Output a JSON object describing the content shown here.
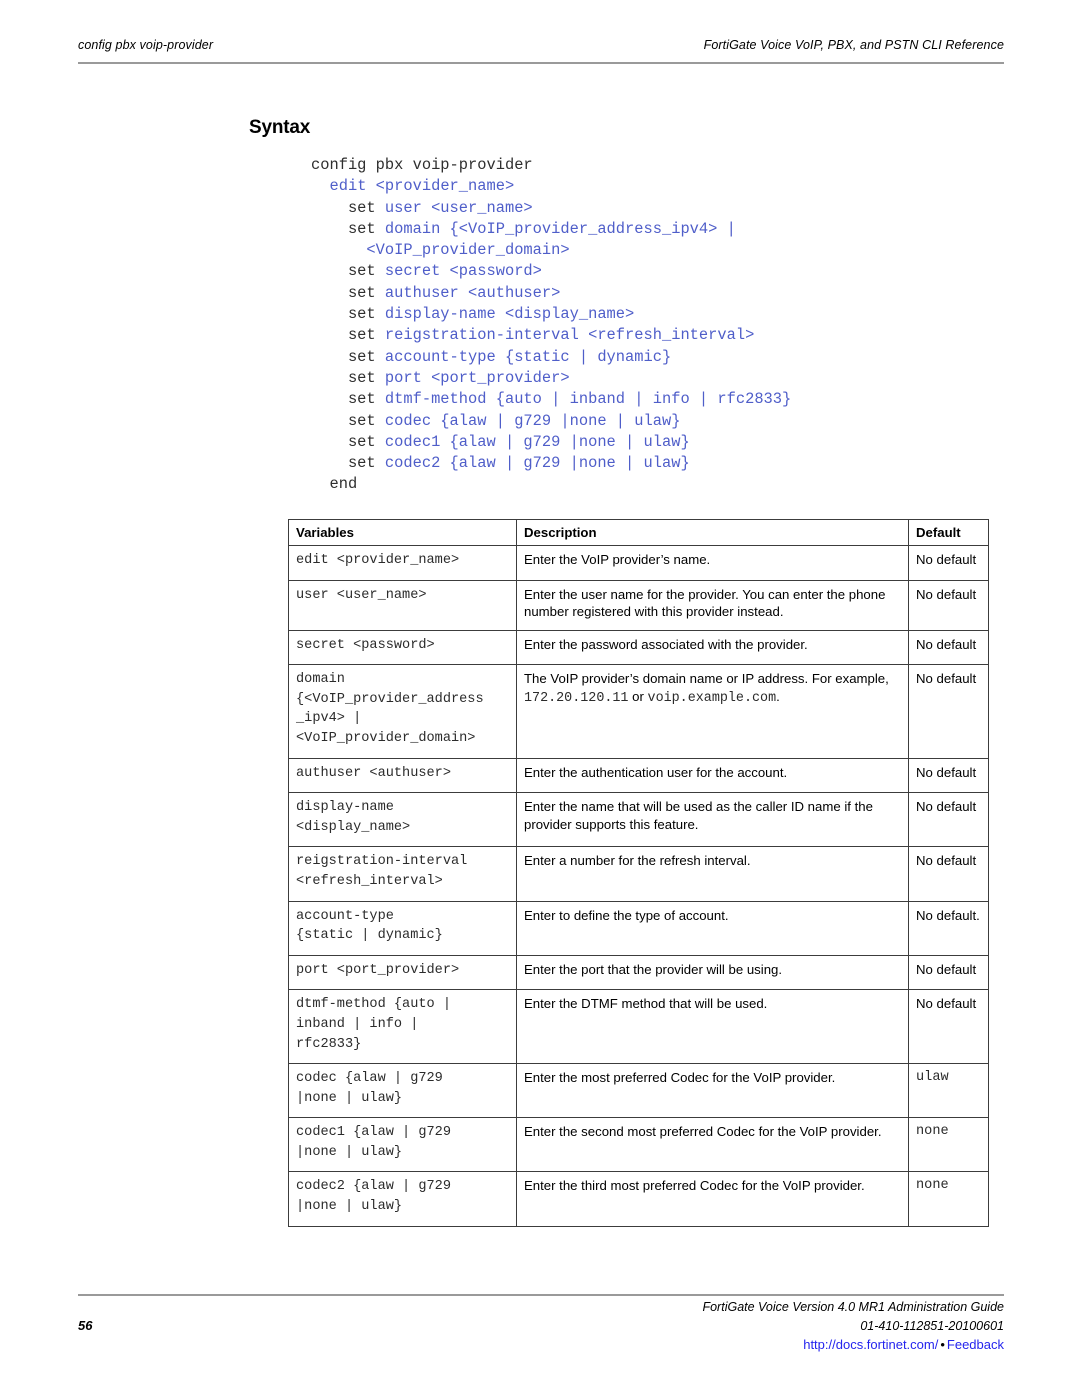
{
  "header": {
    "left": "config pbx voip-provider",
    "right": "FortiGate Voice VoIP, PBX, and PSTN CLI Reference"
  },
  "section": {
    "heading": "Syntax"
  },
  "code": {
    "lines": [
      [
        {
          "t": "config pbx voip-provider",
          "c": "kw"
        }
      ],
      [
        {
          "t": "  ",
          "c": "kw"
        },
        {
          "t": "edit <provider_name>",
          "c": "blue"
        }
      ],
      [
        {
          "t": "    set ",
          "c": "kw"
        },
        {
          "t": "user <user_name>",
          "c": "blue"
        }
      ],
      [
        {
          "t": "    set ",
          "c": "kw"
        },
        {
          "t": "domain {<VoIP_provider_address_ipv4> |",
          "c": "blue"
        }
      ],
      [
        {
          "t": "      ",
          "c": "kw"
        },
        {
          "t": "<VoIP_provider_domain>",
          "c": "blue"
        }
      ],
      [
        {
          "t": "    set ",
          "c": "kw"
        },
        {
          "t": "secret <password>",
          "c": "blue"
        }
      ],
      [
        {
          "t": "    set ",
          "c": "kw"
        },
        {
          "t": "authuser <authuser>",
          "c": "blue"
        }
      ],
      [
        {
          "t": "    set ",
          "c": "kw"
        },
        {
          "t": "display-name <display_name>",
          "c": "blue"
        }
      ],
      [
        {
          "t": "    set ",
          "c": "kw"
        },
        {
          "t": "reigstration-interval <refresh_interval>",
          "c": "blue"
        }
      ],
      [
        {
          "t": "    set ",
          "c": "kw"
        },
        {
          "t": "account-type {static | dynamic}",
          "c": "blue"
        }
      ],
      [
        {
          "t": "    set ",
          "c": "kw"
        },
        {
          "t": "port <port_provider>",
          "c": "blue"
        }
      ],
      [
        {
          "t": "    set ",
          "c": "kw"
        },
        {
          "t": "dtmf-method {auto | inband | info | rfc2833}",
          "c": "blue"
        }
      ],
      [
        {
          "t": "    set ",
          "c": "kw"
        },
        {
          "t": "codec {alaw | g729 |none | ulaw}",
          "c": "blue"
        }
      ],
      [
        {
          "t": "    set ",
          "c": "kw"
        },
        {
          "t": "codec1 {alaw | g729 |none | ulaw}",
          "c": "blue"
        }
      ],
      [
        {
          "t": "    set ",
          "c": "kw"
        },
        {
          "t": "codec2 {alaw | g729 |none | ulaw}",
          "c": "blue"
        }
      ],
      [
        {
          "t": "  end",
          "c": "kw"
        }
      ]
    ]
  },
  "table": {
    "headers": [
      "Variables",
      "Description",
      "Default"
    ],
    "rows": [
      {
        "variable": "edit <provider_name>",
        "description": "Enter the VoIP provider’s name.",
        "default": "No default",
        "default_mono": false
      },
      {
        "variable": "user <user_name>",
        "description": "Enter the user name for the provider. You can enter the phone number registered with this provider instead.",
        "default": "No default",
        "default_mono": false
      },
      {
        "variable": "secret <password>",
        "description": "Enter the password associated with the provider.",
        "default": "No default",
        "default_mono": false
      },
      {
        "variable": "domain\n{<VoIP_provider_address\n_ipv4> |\n<VoIP_provider_domain>",
        "description_parts": [
          {
            "t": "The VoIP provider’s domain name or IP address. For example, ",
            "mono": false
          },
          {
            "t": "172.20.120.11",
            "mono": true
          },
          {
            "t": " or ",
            "mono": false
          },
          {
            "t": "voip.example.com",
            "mono": true
          },
          {
            "t": ".",
            "mono": false
          }
        ],
        "default": "No default",
        "default_mono": false
      },
      {
        "variable": "authuser <authuser>",
        "description": "Enter the authentication user for the account.",
        "default": "No default",
        "default_mono": false
      },
      {
        "variable": "display-name\n<display_name>",
        "description": "Enter the name that will be used as the caller ID name if the provider supports this feature.",
        "default": "No default",
        "default_mono": false
      },
      {
        "variable": "reigstration-interval\n<refresh_interval>",
        "description": "Enter a number for the refresh interval.",
        "default": "No default",
        "default_mono": false
      },
      {
        "variable": "account-type\n{static | dynamic}",
        "description": "Enter to define the type of account.",
        "default": "No default.",
        "default_mono": false
      },
      {
        "variable": "port <port_provider>",
        "description": "Enter the port that the provider will be using.",
        "default": "No default",
        "default_mono": false
      },
      {
        "variable": "dtmf-method {auto |\ninband | info |\nrfc2833}",
        "description": "Enter the DTMF method that will be used.",
        "default": "No default",
        "default_mono": false
      },
      {
        "variable": "codec {alaw | g729\n|none | ulaw}",
        "description": "Enter the most preferred Codec for the VoIP provider.",
        "default": "ulaw",
        "default_mono": true
      },
      {
        "variable": "codec1 {alaw | g729\n|none | ulaw}",
        "description": "Enter the second most preferred Codec for the VoIP provider.",
        "default": "none",
        "default_mono": true
      },
      {
        "variable": "codec2 {alaw | g729\n|none | ulaw}",
        "description": "Enter the third most preferred Codec for the VoIP provider.",
        "default": "none",
        "default_mono": true
      }
    ]
  },
  "footer": {
    "page_number": "56",
    "guide_title": "FortiGate Voice Version 4.0 MR1 Administration Guide",
    "doc_id": "01-410-112851-20100601",
    "url_text": "http://docs.fortinet.com/",
    "separator": "•",
    "feedback_text": "Feedback"
  },
  "colors": {
    "code_blue": "#4f5ec9",
    "link_blue": "#2424ee",
    "rule_gray": "#9a9a9a",
    "table_border": "#3c3c3c"
  }
}
